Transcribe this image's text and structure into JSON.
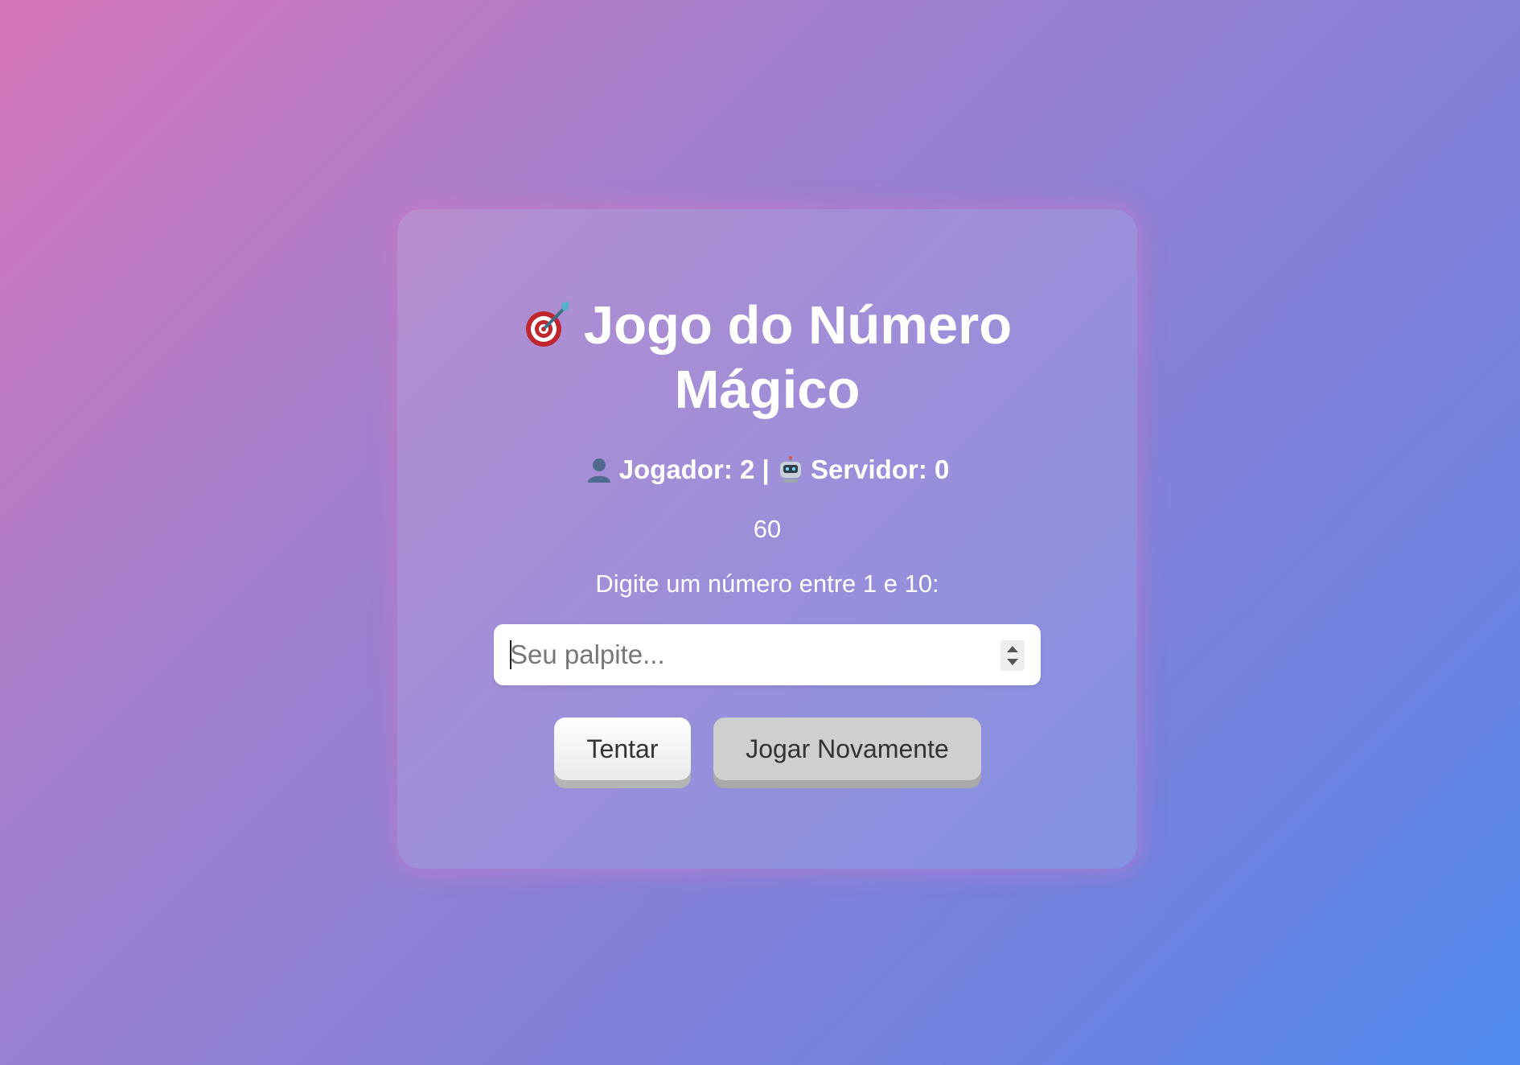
{
  "game": {
    "title": "Jogo do Número Mágico",
    "title_icon": "dart-target-icon",
    "score": {
      "player_icon": "person-silhouette-icon",
      "player_label": "Jogador: 2",
      "separator": "|",
      "server_icon": "robot-icon",
      "server_label": "Servidor: 0"
    },
    "timer": "60",
    "prompt": "Digite um número entre 1 e 10:",
    "guess_input": {
      "placeholder": "Seu palpite...",
      "value": ""
    },
    "buttons": {
      "try_label": "Tentar",
      "play_again_label": "Jogar Novamente"
    }
  },
  "colors": {
    "background_start": "#d675b9",
    "background_end": "#4f8aef",
    "text": "#ffffff"
  }
}
